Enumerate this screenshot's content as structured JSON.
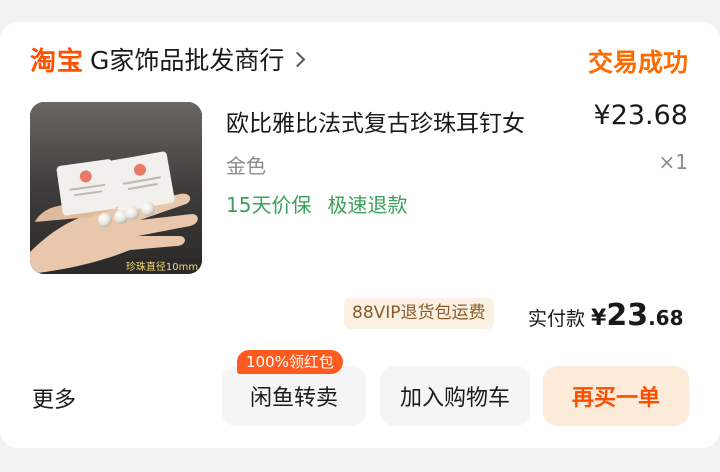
{
  "store": {
    "platform_logo": "淘宝",
    "name": "G家饰品批发商行",
    "status": "交易成功"
  },
  "product": {
    "title": "欧比雅比法式复古珍珠耳钉女",
    "price": "¥23.68",
    "variant": "金色",
    "quantity": "×1",
    "services": [
      "15天价保",
      "极速退款"
    ],
    "image_caption": "珍珠直径10mm"
  },
  "payment": {
    "vip_badge": "88VIP退货包运费",
    "label": "实付款",
    "currency": "¥",
    "amount_int": "23",
    "amount_dec": ".68"
  },
  "actions": {
    "more": "更多",
    "xianyu_resell": "闲鱼转卖",
    "promo_tag": "100%领红包",
    "add_to_cart": "加入购物车",
    "buy_again": "再买一单"
  },
  "colors": {
    "accent_orange": "#ff6a00",
    "service_green": "#3aa05b"
  }
}
